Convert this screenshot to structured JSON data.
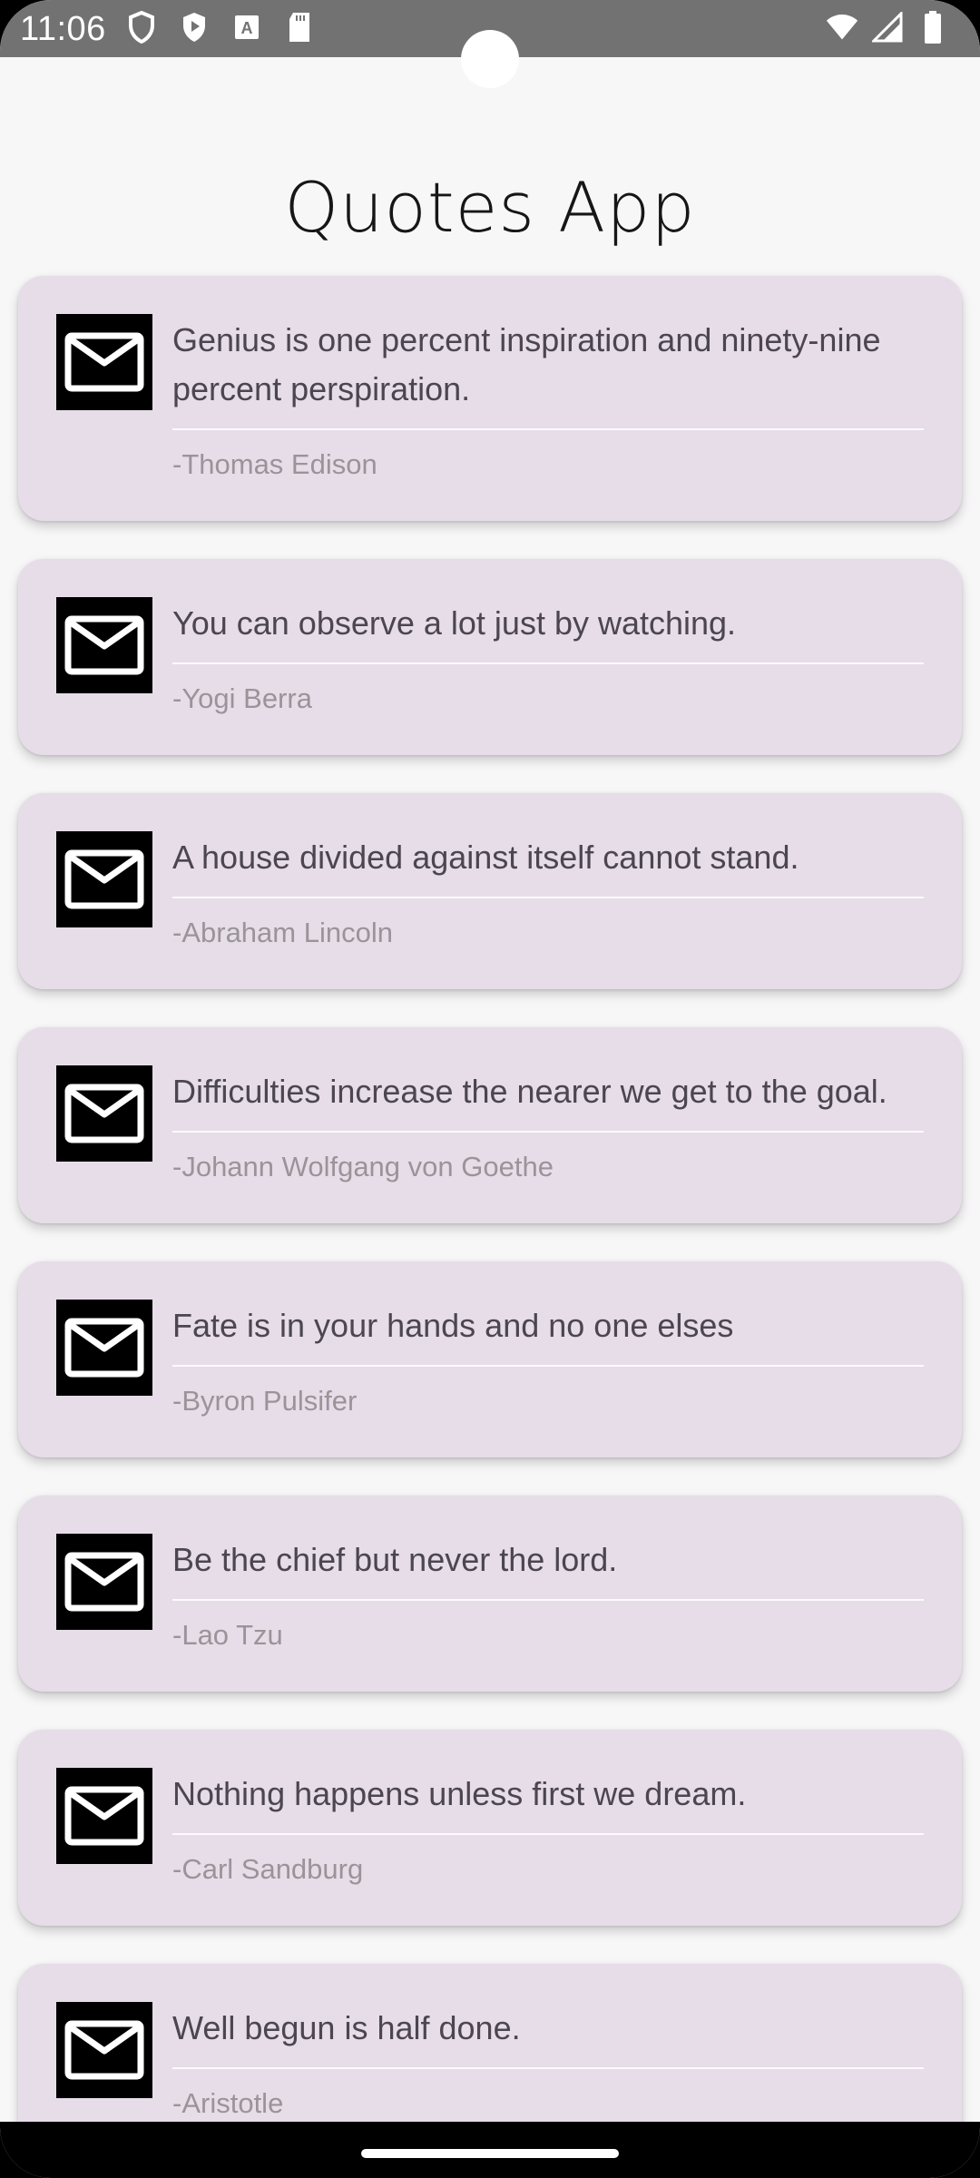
{
  "status_bar": {
    "time": "11:06",
    "left_icons": [
      "shield-icon",
      "play-protect-icon",
      "text-box-icon",
      "sd-card-icon"
    ],
    "right_icons": [
      "wifi-icon",
      "cell-signal-icon",
      "battery-icon"
    ]
  },
  "header": {
    "title": "Quotes App"
  },
  "quotes": [
    {
      "text": "Genius is one percent inspiration and ninety-nine percent perspiration.",
      "author": "-Thomas Edison",
      "icon": "mail-icon"
    },
    {
      "text": "You can observe a lot just by watching.",
      "author": "-Yogi Berra",
      "icon": "mail-icon"
    },
    {
      "text": "A house divided against itself cannot stand.",
      "author": "-Abraham Lincoln",
      "icon": "mail-icon"
    },
    {
      "text": "Difficulties increase the nearer we get to the goal.",
      "author": "-Johann Wolfgang von Goethe",
      "icon": "mail-icon"
    },
    {
      "text": "Fate is in your hands and no one elses",
      "author": "-Byron Pulsifer",
      "icon": "mail-icon"
    },
    {
      "text": "Be the chief but never the lord.",
      "author": "-Lao Tzu",
      "icon": "mail-icon"
    },
    {
      "text": "Nothing happens unless first we dream.",
      "author": "-Carl Sandburg",
      "icon": "mail-icon"
    },
    {
      "text": "Well begun is half done.",
      "author": "-Aristotle",
      "icon": "mail-icon"
    }
  ],
  "theme": {
    "card_background": "#e6dde8",
    "page_background": "#f8f7f8",
    "status_bar_background": "#727272",
    "nav_bar_background": "#000000",
    "quote_text_color": "#4b4650",
    "author_text_color": "#9a9499"
  }
}
